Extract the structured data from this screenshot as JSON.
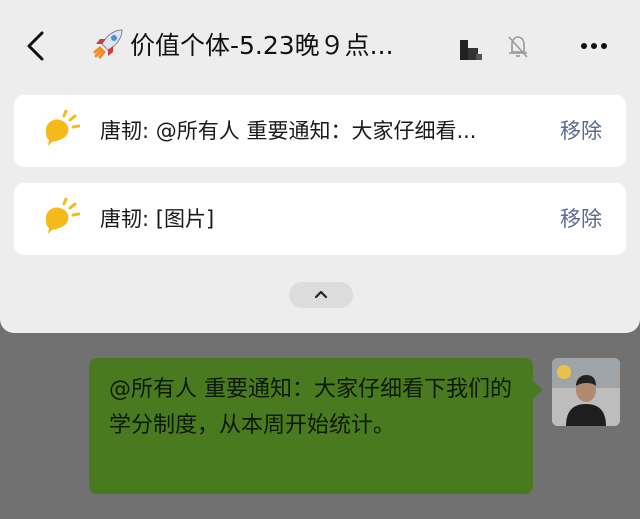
{
  "header": {
    "title": "价值个体-5.23晚９点...",
    "title_emoji": "rocket-icon"
  },
  "pinned": [
    {
      "sender": "唐韧: ",
      "text": "@所有人 重要通知：大家仔细看...",
      "action": "移除"
    },
    {
      "sender": "唐韧: ",
      "text": "[图片]",
      "action": "移除"
    }
  ],
  "message": {
    "text": "@所有人 重要通知：大家仔细看下我们的学分制度，从本周开始统计。"
  },
  "colors": {
    "panel_bg": "#ededed",
    "card_bg": "#ffffff",
    "remove_link": "#586a91",
    "bubble_bg": "#4a7a1f",
    "chat_overlay": "#717171"
  }
}
